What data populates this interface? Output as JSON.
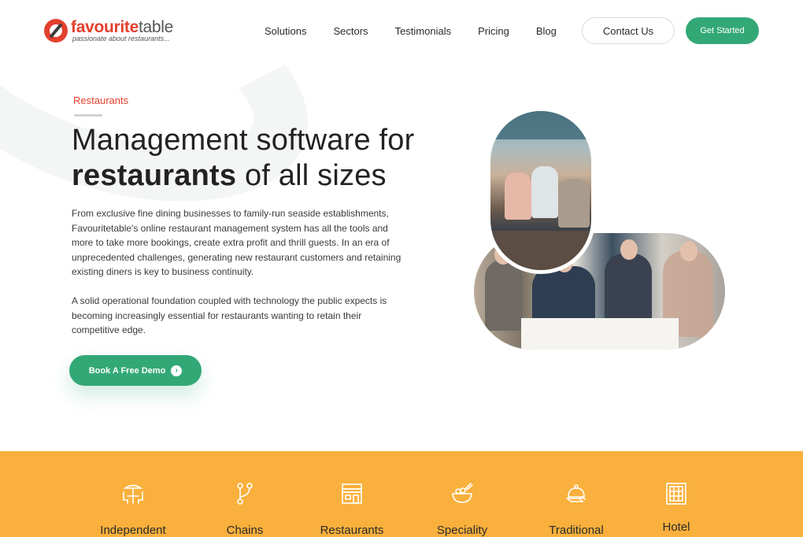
{
  "header": {
    "logo": {
      "name_part1": "favourite",
      "name_part2": "table",
      "tagline": "passionate about restaurants..."
    },
    "nav": [
      "Solutions",
      "Sectors",
      "Testimonials",
      "Pricing",
      "Blog"
    ],
    "contact_label": "Contact Us",
    "get_started_label": "Get Started"
  },
  "hero": {
    "eyebrow": "Restaurants",
    "title_line1": "Management software for",
    "title_bold": "restaurants",
    "title_rest": " of all sizes",
    "para1": "From exclusive fine dining businesses to family-run seaside establishments, Favouritetable's online restaurant management system has all the tools and more to take more bookings, create extra profit and thrill guests. In an era of unprecedented challenges, generating new restaurant customers and retaining existing diners is key to business continuity.",
    "para2": "A solid operational foundation coupled with technology the public expects is becoming increasingly essential for restaurants wanting to retain their competitive edge.",
    "cta_label": "Book A Free Demo"
  },
  "sectors": [
    {
      "label": "Independent",
      "icon": "outdoor-table-icon"
    },
    {
      "label": "Chains",
      "icon": "branch-icon"
    },
    {
      "label": "Restaurants",
      "icon": "storefront-icon"
    },
    {
      "label": "Speciality",
      "icon": "bowl-icon"
    },
    {
      "label": "Traditional",
      "icon": "cloche-icon"
    },
    {
      "label": "Hotel",
      "icon": "building-icon"
    }
  ],
  "colors": {
    "brand_red": "#e3402e",
    "brand_green": "#33a877",
    "band_orange": "#f9b03c"
  }
}
